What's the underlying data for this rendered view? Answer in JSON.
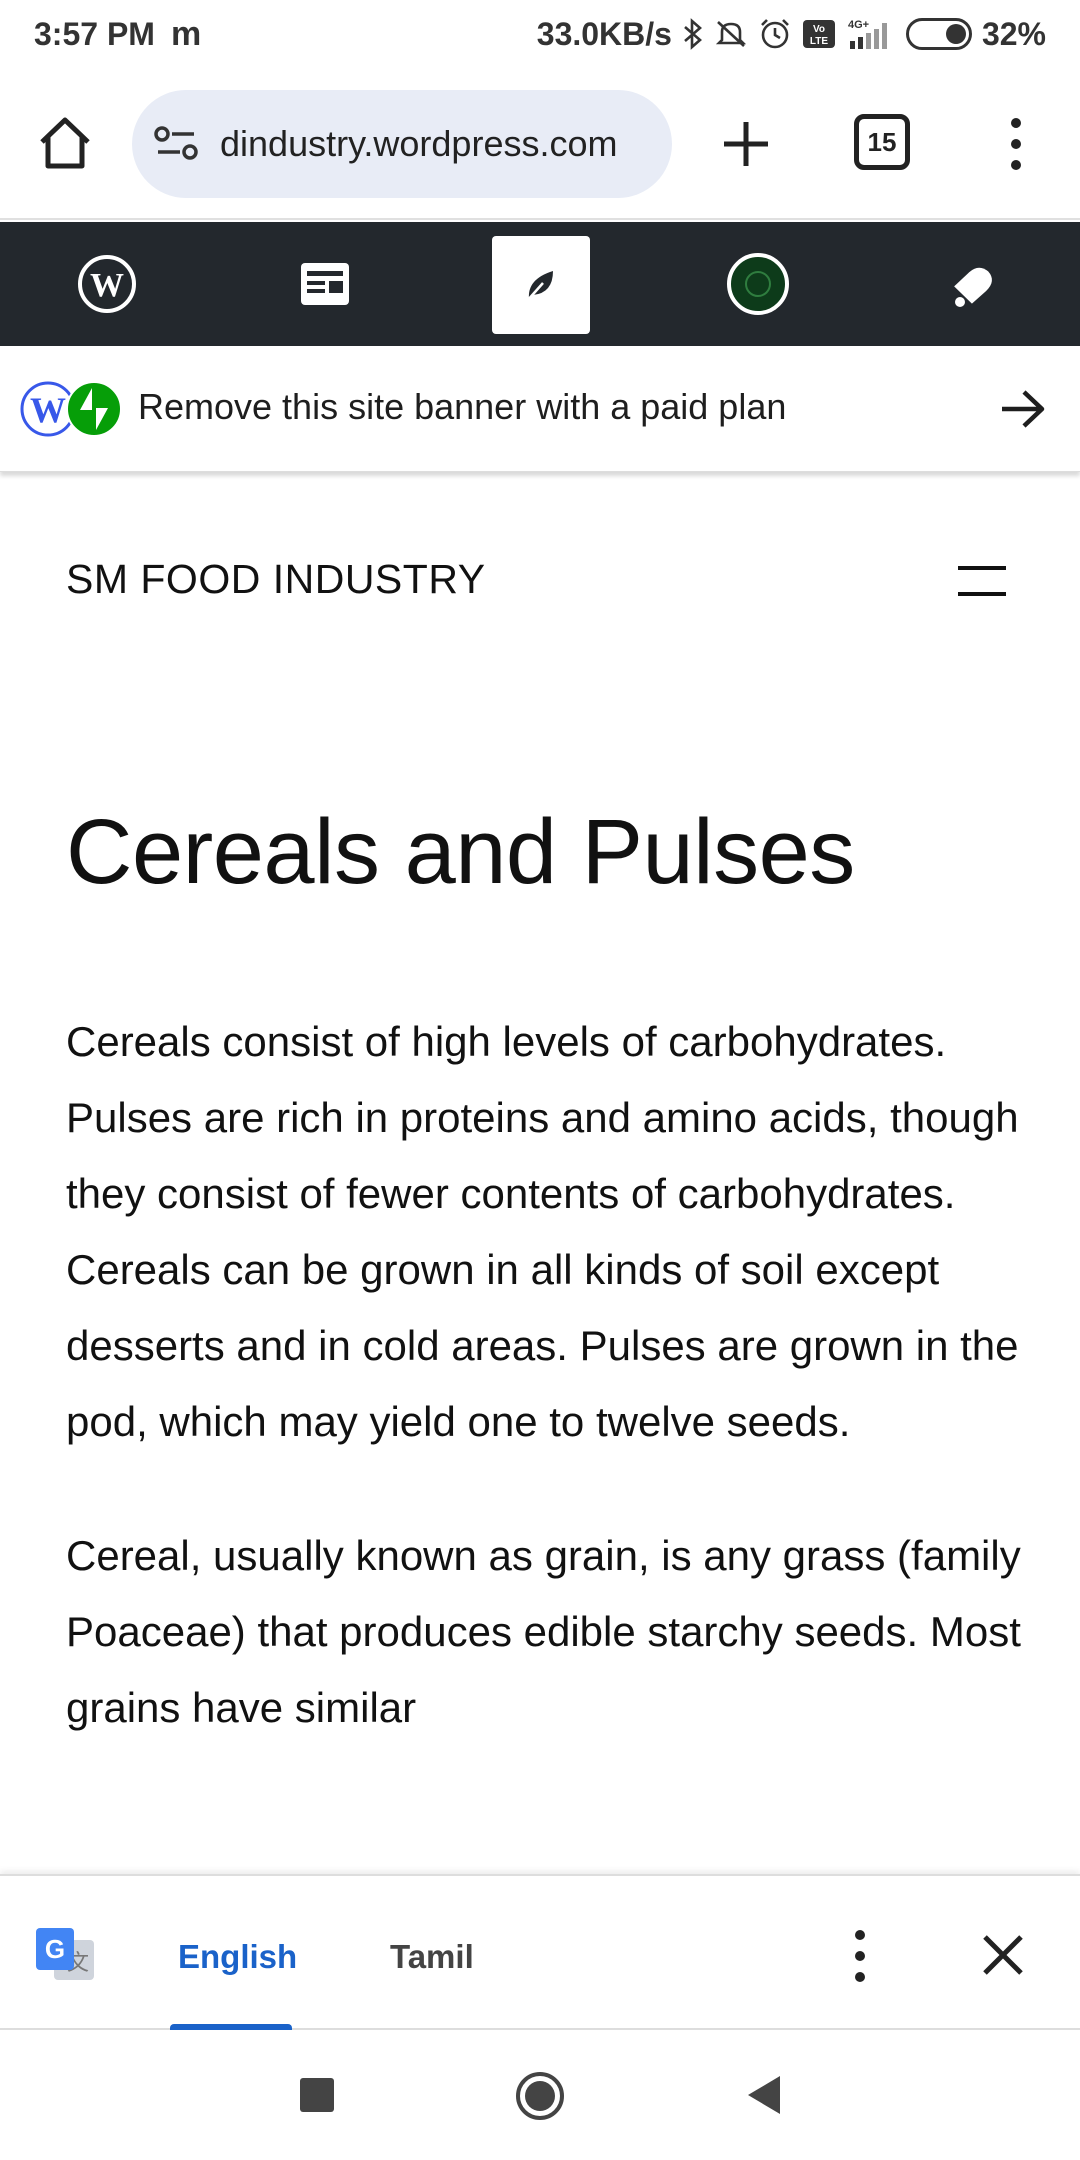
{
  "status_bar": {
    "time": "3:57 PM",
    "notification_glyph": "m",
    "network_speed": "33.0KB/s",
    "battery_percent": "32%",
    "icons": [
      "bluetooth-icon",
      "mute-icon",
      "alarm-icon",
      "volte-icon",
      "signal-icon",
      "battery-icon"
    ],
    "volte_label": "Vo LTE",
    "network_type": "4G+"
  },
  "browser": {
    "url": "dindustry.wordpress.com",
    "tab_count": "15",
    "icons": [
      "home-icon",
      "site-info-icon",
      "new-tab-icon",
      "tabs-icon",
      "more-menu-icon"
    ]
  },
  "wp_admin_bar": {
    "items": [
      "wordpress-logo-icon",
      "reader-icon",
      "site-editor-icon",
      "site-avatar-icon",
      "notifications-icon"
    ],
    "active_index": 2
  },
  "banner": {
    "text": "Remove this site banner with a paid plan",
    "icons": [
      "wordpress-logo-icon",
      "jetpack-icon",
      "arrow-right-icon"
    ]
  },
  "site": {
    "title": "SM FOOD INDUSTRY"
  },
  "article": {
    "heading": "Cereals and Pulses",
    "paragraphs": [
      "Cereals consist of high levels of carbohydrates. Pulses are rich in proteins and amino acids, though they consist of fewer contents of carbohydrates. Cereals can be grown in all kinds of soil except desserts and in cold areas. Pulses are grown in the pod, which may yield one to twelve seeds.",
      "Cereal, usually known as grain, is any grass (family Poaceae) that produces edible starchy seeds. Most grains have similar"
    ]
  },
  "translate_bar": {
    "languages": [
      "English",
      "Tamil"
    ],
    "selected": "English"
  },
  "colors": {
    "wp_bar": "#23282d",
    "omnibox_bg": "#e8ecf6",
    "translate_accent": "#1a62c9",
    "jetpack_green": "#069e08",
    "wordpress_blue": "#3858e9"
  }
}
